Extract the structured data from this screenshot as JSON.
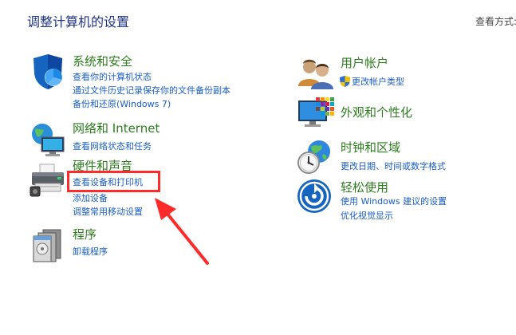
{
  "header": {
    "title": "调整计算机的设置",
    "view_by": "查看方式:"
  },
  "categories": [
    {
      "id": "system-security",
      "title": "系统和安全",
      "icon": "shield-icon",
      "links": [
        "查看你的计算机状态",
        "通过文件历史记录保存你的文件备份副本",
        "备份和还原(Windows 7)"
      ]
    },
    {
      "id": "network",
      "title": "网络和 Internet",
      "icon": "network-globe-icon",
      "links": [
        "查看网络状态和任务"
      ]
    },
    {
      "id": "hardware-sound",
      "title": "硬件和声音",
      "icon": "printer-icon",
      "links": [
        "查看设备和打印机",
        "添加设备",
        "调整常用移动设置"
      ]
    },
    {
      "id": "programs",
      "title": "程序",
      "icon": "programs-icon",
      "links": [
        "卸载程序"
      ]
    },
    {
      "id": "user-accounts",
      "title": "用户帐户",
      "icon": "users-icon",
      "links": [
        "更改帐户类型"
      ]
    },
    {
      "id": "appearance",
      "title": "外观和个性化",
      "icon": "monitor-palette-icon",
      "links": []
    },
    {
      "id": "clock-region",
      "title": "时钟和区域",
      "icon": "clock-globe-icon",
      "links": [
        "更改日期、时间或数字格式"
      ]
    },
    {
      "id": "ease-of-access",
      "title": "轻松使用",
      "icon": "ease-of-access-icon",
      "links": [
        "使用 Windows 建议的设置",
        "优化视觉显示"
      ]
    }
  ],
  "annotation": {
    "highlight_color": "#ff2a2a",
    "target": "查看设备和打印机"
  },
  "colors": {
    "title": "#1e3287",
    "category": "#2d7d1e",
    "link": "#1a5ec9"
  }
}
